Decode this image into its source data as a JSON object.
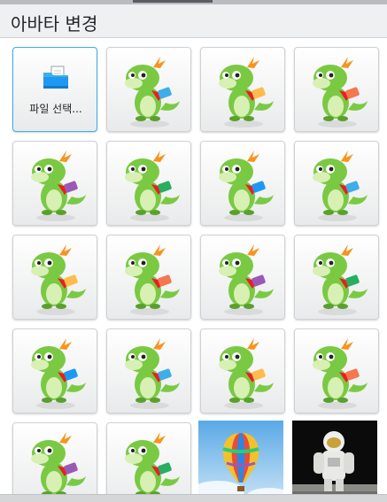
{
  "dialog": {
    "title": "아바타 변경"
  },
  "avatars": {
    "file_picker_label": "파일 선택...",
    "items": [
      {
        "kind": "file-picker",
        "icon": "folder-icon"
      },
      {
        "kind": "mascot",
        "name": "konqi-artist"
      },
      {
        "kind": "mascot",
        "name": "konqi-office"
      },
      {
        "kind": "mascot",
        "name": "konqi-business"
      },
      {
        "kind": "mascot",
        "name": "konqi-bughunter"
      },
      {
        "kind": "mascot",
        "name": "konqi-reader"
      },
      {
        "kind": "mascot",
        "name": "konqi-sysadmin"
      },
      {
        "kind": "mascot",
        "name": "konqi-photographer"
      },
      {
        "kind": "mascot",
        "name": "katie-tablet"
      },
      {
        "kind": "mascot",
        "name": "konqi-presenter"
      },
      {
        "kind": "mascot",
        "name": "konqi-mechanic"
      },
      {
        "kind": "mascot",
        "name": "konqi-dev"
      },
      {
        "kind": "mascot",
        "name": "konqi-music"
      },
      {
        "kind": "mascot",
        "name": "konqi-desk"
      },
      {
        "kind": "mascot",
        "name": "konqi-hardware"
      },
      {
        "kind": "mascot",
        "name": "konqi-science"
      },
      {
        "kind": "mascot",
        "name": "konqi-teacher"
      },
      {
        "kind": "mascot",
        "name": "konqi-wave"
      },
      {
        "kind": "photo",
        "name": "hot-air-balloon"
      },
      {
        "kind": "photo",
        "name": "astronaut"
      }
    ]
  },
  "colors": {
    "selection": "#3daee9",
    "dragon_green": "#7ac943",
    "dragon_belly": "#d8f0b4",
    "horns": "#f7941d",
    "scarf": "#ed1c24"
  }
}
